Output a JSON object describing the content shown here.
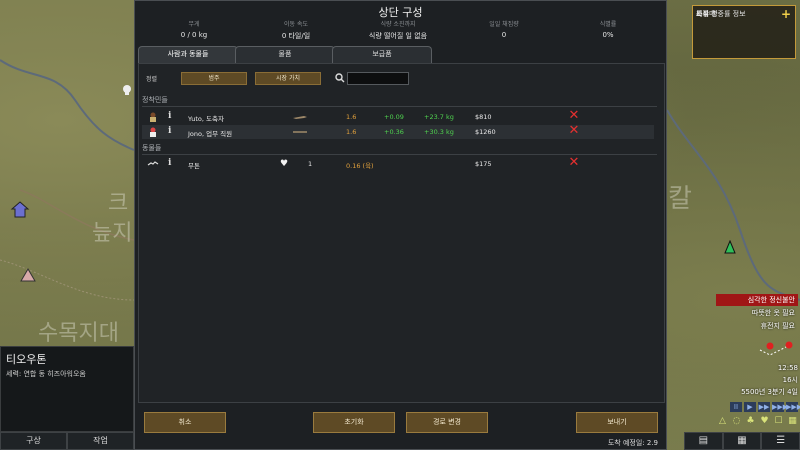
{
  "map": {
    "labels": [
      "크",
      "늪지",
      "수목지대",
      "칼"
    ]
  },
  "left_panel": {
    "name": "티오우톤",
    "faction": "세력: 연합 동 히즈아워오옴",
    "tabs": [
      "구상",
      "작업"
    ]
  },
  "right_panel": {
    "items": [
      "도우미",
      "복장",
      "기록 창",
      "사격 명중률 정보"
    ],
    "alerts": [
      {
        "text": "심각한 정신불안",
        "style": "red"
      },
      {
        "text": "따뜻한 옷 필요",
        "style": "plain"
      },
      {
        "text": "휴전지 필요",
        "style": "plain"
      }
    ],
    "time": "12:58",
    "hour": "16시",
    "date": "5500년 3분기 4일",
    "speed_controls": [
      "II",
      "▶",
      "▶▶",
      "▶▶▶",
      "▶▶▶▶"
    ],
    "overlay_icons": [
      "△",
      "◌",
      "♣",
      "♥",
      "☐",
      "▦"
    ],
    "bottom_buttons": [
      "▤",
      "▦",
      "☰"
    ]
  },
  "dialog": {
    "title": "상단 구성",
    "stats": [
      {
        "label": "무게",
        "value": "0 / 0 kg"
      },
      {
        "label": "이동 속도",
        "value": "0 타일/일"
      },
      {
        "label": "식량 소진까지",
        "value": "식량 떨어질 일 없음"
      },
      {
        "label": "일일 채집량",
        "value": "0"
      },
      {
        "label": "식별률",
        "value": "0%"
      }
    ],
    "tabs": [
      "사람과 동물들",
      "물품",
      "보급품"
    ],
    "active_tab": 0,
    "sort_label": "정렬",
    "sort_buttons": [
      "범주",
      "시장 가치"
    ],
    "search_value": "",
    "sections": {
      "colonists": "정착민들",
      "animals": "동물들"
    },
    "colonists": [
      {
        "name": "Yuto, 도축자",
        "mass": "1.6",
        "speed": "+0.09",
        "capacity": "+23.7 kg",
        "value": "$810"
      },
      {
        "name": "Jono, 업무 직원",
        "mass": "1.6",
        "speed": "+0.36",
        "capacity": "+30.3 kg",
        "value": "$1260"
      }
    ],
    "animals": [
      {
        "name": "무톤",
        "count": "1",
        "food": "0.16 (육)",
        "value": "$175"
      }
    ],
    "footer": {
      "cancel": "취소",
      "reset": "초기화",
      "change_route": "경로 변경",
      "send": "보내기",
      "eta": "도착 예정일: 2.9"
    }
  }
}
